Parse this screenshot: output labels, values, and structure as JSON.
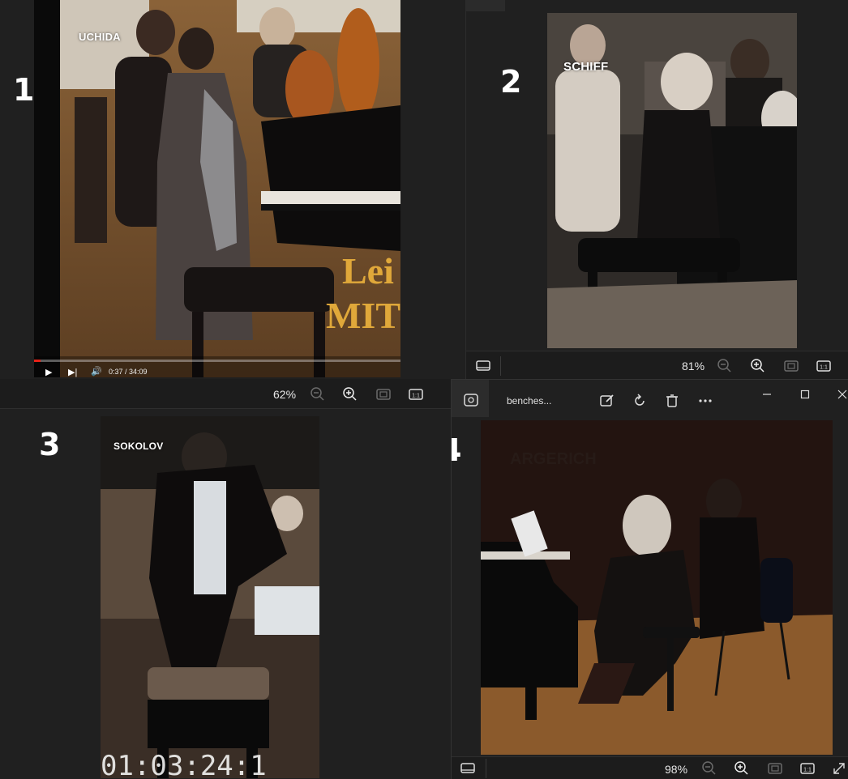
{
  "panels": [
    {
      "number": "1",
      "performer": "UCHIDA"
    },
    {
      "number": "2",
      "performer": "SCHIFF"
    },
    {
      "number": "3",
      "performer": "SOKOLOV"
    },
    {
      "number": "4",
      "performer": "ARGERICH"
    }
  ],
  "video": {
    "timecode": "0:37 / 34:09",
    "overlay_text": "Lei\nMIT",
    "progress_fraction": 0.018
  },
  "viewer_2": {
    "zoom": "81%"
  },
  "viewer_3": {
    "zoom": "62%",
    "timestamp_overlay": "01:03:24:1"
  },
  "viewer_4": {
    "title": "benches...",
    "zoom": "98%"
  },
  "icons": {
    "filmstrip": "filmstrip-icon",
    "zoom_out": "zoom-out-icon",
    "zoom_in": "zoom-in-icon",
    "fit": "fit-to-window-icon",
    "actual_size": "actual-size-icon",
    "edit": "edit-icon",
    "rotate": "rotate-icon",
    "delete": "delete-icon",
    "more": "more-icon",
    "minimize": "minimize-icon",
    "maximize": "maximize-icon",
    "close": "close-icon",
    "app": "photos-app-icon"
  },
  "colors": {
    "background": "#202020",
    "toolbar": "#1c1c1c",
    "accent_progress": "#e62117"
  }
}
